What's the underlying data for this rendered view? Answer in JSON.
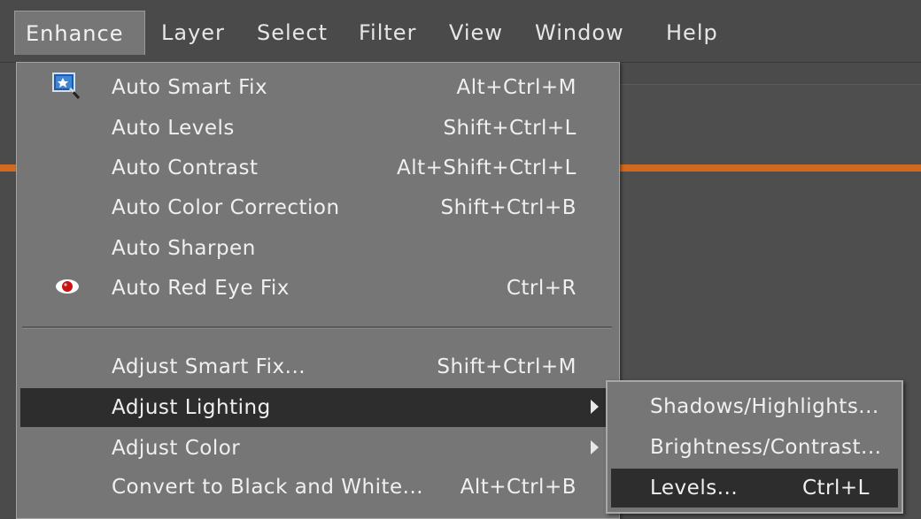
{
  "menubar": {
    "items": [
      {
        "label": "Enhance",
        "active": true
      },
      {
        "label": "Layer"
      },
      {
        "label": "Select"
      },
      {
        "label": "Filter"
      },
      {
        "label": "View"
      },
      {
        "label": "Window"
      },
      {
        "label": "Help"
      }
    ]
  },
  "enhance_menu": {
    "items": [
      {
        "label": "Auto Smart Fix",
        "shortcut": "Alt+Ctrl+M",
        "icon": "auto-smart-fix-icon"
      },
      {
        "label": "Auto Levels",
        "shortcut": "Shift+Ctrl+L"
      },
      {
        "label": "Auto Contrast",
        "shortcut": "Alt+Shift+Ctrl+L"
      },
      {
        "label": "Auto Color Correction",
        "shortcut": "Shift+Ctrl+B"
      },
      {
        "label": "Auto Sharpen",
        "shortcut": ""
      },
      {
        "label": "Auto Red Eye Fix",
        "shortcut": "Ctrl+R",
        "icon": "red-eye-icon"
      },
      {
        "label": "Adjust Smart Fix...",
        "shortcut": "Shift+Ctrl+M"
      },
      {
        "label": "Adjust Lighting",
        "submenu": true,
        "highlighted": true
      },
      {
        "label": "Adjust Color",
        "submenu": true
      },
      {
        "label": "Convert to Black and White...",
        "shortcut": "Alt+Ctrl+B"
      }
    ]
  },
  "lighting_submenu": {
    "items": [
      {
        "label": "Shadows/Highlights...",
        "shortcut": ""
      },
      {
        "label": "Brightness/Contrast...",
        "shortcut": ""
      },
      {
        "label": "Levels...",
        "shortcut": "Ctrl+L",
        "highlighted": true
      }
    ]
  },
  "colors": {
    "menu_bg": "#767676",
    "highlight_bg": "#2d2d2d",
    "accent_strip": "#d2691e",
    "text": "#f0f0f0"
  }
}
